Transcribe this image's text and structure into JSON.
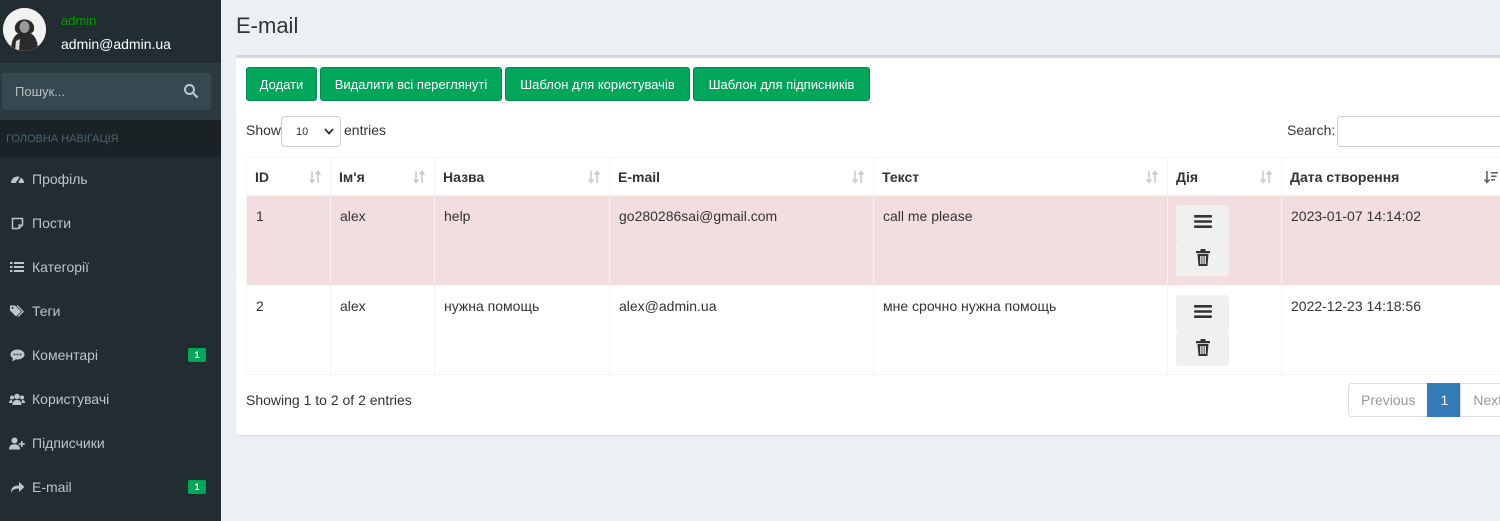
{
  "user": {
    "name": "admin",
    "email": "admin@admin.ua"
  },
  "sidebar": {
    "search_placeholder": "Пошук...",
    "header": "ГОЛОВНА НАВІГАЦІЯ",
    "items": [
      {
        "label": "Профіль",
        "icon": "dashboard-icon"
      },
      {
        "label": "Пости",
        "icon": "post-icon"
      },
      {
        "label": "Категорії",
        "icon": "list-icon"
      },
      {
        "label": "Теги",
        "icon": "tags-icon"
      },
      {
        "label": "Коментарі",
        "icon": "comment-icon",
        "badge": "1"
      },
      {
        "label": "Користувачі",
        "icon": "users-icon"
      },
      {
        "label": "Підписчики",
        "icon": "user-plus-icon"
      },
      {
        "label": "E-mail",
        "icon": "share-icon",
        "badge": "1"
      }
    ]
  },
  "page": {
    "title": "E-mail"
  },
  "toolbar": {
    "add": "Додати",
    "delete_viewed": "Видалити всі переглянуті",
    "user_template": "Шаблон для користувачів",
    "subscriber_template": "Шаблон для підписників"
  },
  "table_controls": {
    "show": "Show",
    "entries": "entries",
    "page_length": "10",
    "search": "Search:"
  },
  "table": {
    "columns": [
      "ID",
      "Ім'я",
      "Назва",
      "E-mail",
      "Текст",
      "Дія",
      "Дата створення"
    ],
    "rows": [
      {
        "id": "1",
        "name": "alex",
        "title": "help",
        "email": "go280286sai@gmail.com",
        "text": "call me please",
        "date": "2023-01-07 14:14:02"
      },
      {
        "id": "2",
        "name": "alex",
        "title": "нужна помощь",
        "email": "alex@admin.ua",
        "text": "мне срочно нужна помощь",
        "date": "2022-12-23 14:18:56"
      }
    ]
  },
  "footer": {
    "info": "Showing 1 to 2 of 2 entries",
    "previous": "Previous",
    "current_page": "1",
    "next": "Next"
  },
  "colors": {
    "sidebar": "#222d32",
    "accent_green": "#00a65a",
    "pager_active": "#337ab7",
    "unread_row": "#f2dede"
  }
}
